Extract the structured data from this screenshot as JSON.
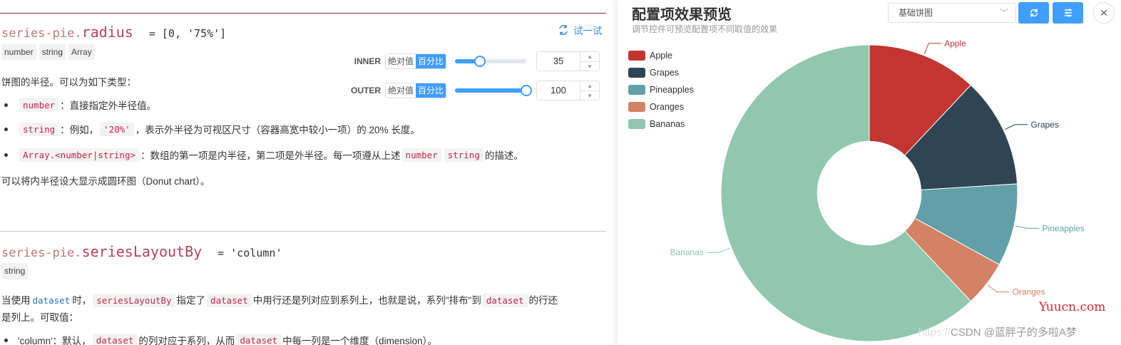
{
  "doc": {
    "radius": {
      "prefix": "series-pie.",
      "name": "radius",
      "default": "= [0, '75%']",
      "types": [
        "number",
        "string",
        "Array"
      ],
      "intro": "饼图的半径。可以为如下类型：",
      "bullet1_code": "number",
      "bullet1_text": "：直接指定外半径值。",
      "bullet2_code": "string",
      "bullet2_text1": "：例如，",
      "bullet2_code2": "'20%'",
      "bullet2_text2": "，表示外半径为可视区尺寸（容器高宽中较小一项）的 20% 长度。",
      "bullet3_code": "Array.<number|string>",
      "bullet3_text1": "：数组的第一项是内半径，第二项是外半径。每一项遵从上述",
      "bullet3_code2": "number",
      "bullet3_code3": "string",
      "bullet3_text2": "的描述。",
      "note": "可以将内半径设大显示成圆环图（Donut chart）。"
    },
    "try_label": "试一试",
    "controls": {
      "inner": {
        "label": "INNER",
        "abs": "绝对值",
        "pct": "百分比",
        "value": "35",
        "fraction": 0.35
      },
      "outer": {
        "label": "OUTER",
        "abs": "绝对值",
        "pct": "百分比",
        "value": "100",
        "fraction": 1.0
      }
    },
    "layout": {
      "prefix": "series-pie.",
      "name": "seriesLayoutBy",
      "default": "= 'column'",
      "types": [
        "string"
      ],
      "p1_a": "当使用",
      "p1_code1": "dataset",
      "p1_b": "时，",
      "p1_code2": "seriesLayoutBy",
      "p1_c": "指定了",
      "p1_code3": "dataset",
      "p1_d": "中用行还是列对应到系列上，也就是说，系列\"排布\"到",
      "p1_code4": "dataset",
      "p1_e": "的行还",
      "p1_line2": "是列上。可取值：",
      "b1_a": "'column'：默认，",
      "b1_code1": "dataset",
      "b1_b": "的列对应于系列，从而",
      "b1_code2": "dataset",
      "b1_c": "中每一列是一个维度（dimension）。"
    }
  },
  "preview": {
    "title": "配置项效果预览",
    "subtitle": "调节控件可预览配置项不同取值的效果",
    "select_value": "基础饼图",
    "refresh_icon": "refresh-icon",
    "settings_icon": "settings-icon",
    "close_icon": "close-icon"
  },
  "chart_data": {
    "type": "pie",
    "categories": [
      "Apple",
      "Grapes",
      "Pineapples",
      "Oranges",
      "Bananas"
    ],
    "values": [
      12,
      12,
      9,
      5,
      62
    ],
    "colors": [
      "#c23531",
      "#2f4554",
      "#61a0a8",
      "#d48265",
      "#91c7ae"
    ],
    "inner_radius_fraction": 0.35,
    "legend_position": "top-left",
    "labels": [
      "Apple",
      "Grapes",
      "Pineapples",
      "Oranges",
      "Bananas"
    ]
  },
  "watermark": {
    "site": "Yuucn.com",
    "credit": "CSDN @蓝胖子的多啦A梦"
  }
}
